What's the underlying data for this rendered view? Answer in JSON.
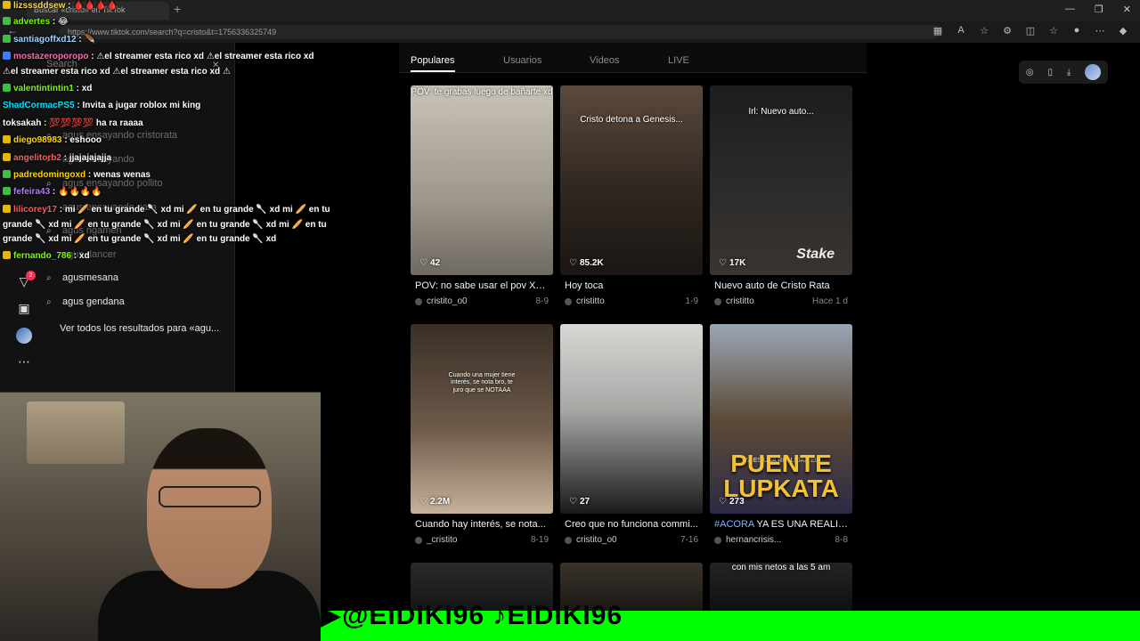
{
  "browser": {
    "tab_label": "Buscar «cristo» en TikTok",
    "url": "https://www.tiktok.com/search?q=cristo&t=1756336325749"
  },
  "sidebar": {
    "search_placeholder": "Search",
    "suggestions": [
      {
        "text": "agus ensayando cristorata",
        "dim": true
      },
      {
        "text": "agus ensayando",
        "dim": true
      },
      {
        "text": "agus ensayando pollito",
        "dim": true
      },
      {
        "text": "agus ensayando para",
        "dim": true
      },
      {
        "text": "agus ngamen",
        "dim": true
      },
      {
        "text": "agus dancer",
        "dim": true
      },
      {
        "text": "agusmesana",
        "dim": false
      },
      {
        "text": "agus gendana",
        "dim": false
      }
    ],
    "see_all": "Ver todos los resultados para «agu...",
    "badge_count": "2"
  },
  "chat": [
    {
      "user": "lizsssddsew",
      "msg": "🩸🩸🩸🩸",
      "user_color": "#f5d76e",
      "icon_color": "#e6b800"
    },
    {
      "user": "advertes",
      "msg": "😂",
      "user_color": "#7cfc00",
      "icon_color": "#3fbf3f"
    },
    {
      "user": "santiagoffxd12",
      "msg": "🪶",
      "user_color": "#9fd3ff",
      "icon_color": "#3fbf3f"
    },
    {
      "user": "mostazeroporopo",
      "msg": "⚠el streamer esta rico xd ⚠el streamer esta rico xd",
      "user_color": "#ff69b4",
      "icon_color": "#3b7fff"
    },
    {
      "user": "",
      "msg": "⚠el streamer esta rico xd ⚠el streamer esta rico xd ⚠",
      "user_color": "#fff",
      "icon_color": ""
    },
    {
      "user": "valentintintin1",
      "msg": "xd",
      "user_color": "#7cfc00",
      "icon_color": "#3fbf3f"
    },
    {
      "user": "ShadCormacPS5",
      "msg": "Invita a jugar roblox mi king",
      "user_color": "#00e5ff",
      "icon_color": ""
    },
    {
      "user": "toksakah",
      "msg": "💯💯💯💯 ha ra raaaa",
      "user_color": "#ffffff",
      "icon_color": ""
    },
    {
      "user": "diego98983",
      "msg": "eshooo",
      "user_color": "#ffd700",
      "icon_color": "#e6b800"
    },
    {
      "user": "angelitorb2",
      "msg": "jjajajajajja",
      "user_color": "#ff5c5c",
      "icon_color": "#e6b800"
    },
    {
      "user": "padredomingoxd",
      "msg": "wenas wenas",
      "user_color": "#ffd700",
      "icon_color": "#3fbf3f"
    },
    {
      "user": "fefeira43",
      "msg": "🔥🔥🔥🔥",
      "user_color": "#b47cff",
      "icon_color": "#3fbf3f"
    },
    {
      "user": "lilicorey17",
      "msg": "mi 🥖 en tu grande 🥄 xd mi 🥖 en tu grande 🥄 xd mi 🥖 en tu",
      "user_color": "#ff5c5c",
      "icon_color": "#e6b800"
    },
    {
      "user": "",
      "msg": "grande 🥄 xd mi 🥖 en tu grande 🥄 xd mi 🥖 en tu grande 🥄 xd mi 🥖 en tu",
      "user_color": "#fff",
      "icon_color": ""
    },
    {
      "user": "",
      "msg": "grande 🥄 xd mi 🥖 en tu grande 🥄 xd mi 🥖 en tu grande 🥄 xd",
      "user_color": "#fff",
      "icon_color": ""
    },
    {
      "user": "fernando_786",
      "msg": "xd",
      "user_color": "#7cfc00",
      "icon_color": "#e6b800"
    }
  ],
  "tabs": [
    {
      "label": "Populares",
      "active": true
    },
    {
      "label": "Usuarios",
      "active": false
    },
    {
      "label": "Videos",
      "active": false
    },
    {
      "label": "LIVE",
      "active": false
    }
  ],
  "videos": [
    {
      "caption_top": "POV: te grabas luego de bañarte xd",
      "likes": "42",
      "title": "POV: no sabe usar el pov XD...",
      "tag": "",
      "author": "cristito_o0",
      "date": "8-9"
    },
    {
      "caption_top": "Cristo detona a Genesis...",
      "likes": "85.2K",
      "title": "Hoy toca",
      "tag": "",
      "author": "cristitto",
      "date": "1-9"
    },
    {
      "caption_top": "Irl: Nuevo auto...",
      "likes": "17K",
      "title": "Nuevo auto de Cristo Rata",
      "tag": "",
      "author": "cristitto",
      "date": "Hace 1 d",
      "overlay": "Stake"
    },
    {
      "caption_top": "Cuando una mujer tiene interés, se nota bro, te juro que se NOTAAA",
      "likes": "2.2M",
      "title": "Cuando hay interés, se nota...",
      "tag": "",
      "author": "_cristito",
      "date": "8-19"
    },
    {
      "caption_top": "",
      "likes": "27",
      "title": "Creo que no funciona commi...",
      "tag": "",
      "author": "cristito_o0",
      "date": "7-16"
    },
    {
      "caption_top": "",
      "likes": "273",
      "title": " YA ES UNA REALID...",
      "tag": "#ACORA",
      "author": "hernancrisis...",
      "date": "8-8",
      "overlay_small": "YA ES UNA REALIDAD EL",
      "overlay": "PUENTE LUPKATA"
    },
    {
      "caption_top": "",
      "likes": "",
      "title": "",
      "tag": "",
      "author": "",
      "date": ""
    },
    {
      "caption_top": "",
      "likes": "",
      "title": "",
      "tag": "",
      "author": "",
      "date": ""
    },
    {
      "caption_top": "con mis netos a las 5 am",
      "likes": "",
      "title": "",
      "tag": "",
      "author": "",
      "date": ""
    }
  ],
  "banner": {
    "text": "▶@EIDIKI96 ♪EIDIKI96"
  }
}
